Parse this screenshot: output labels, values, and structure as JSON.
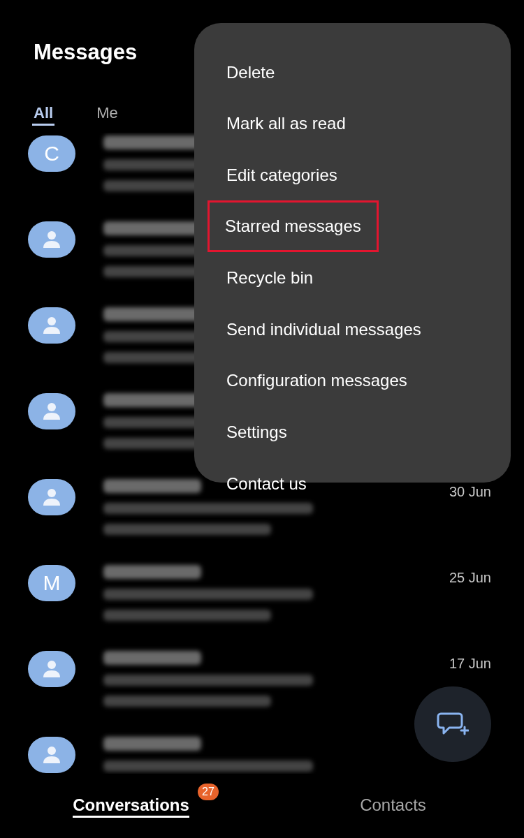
{
  "header": {
    "title": "Messages"
  },
  "filter_tabs": [
    {
      "label": "All",
      "selected": true
    },
    {
      "label": "Me",
      "selected": false
    }
  ],
  "conversations": [
    {
      "avatar": {
        "kind": "letter",
        "letter": "C"
      }
    },
    {
      "avatar": {
        "kind": "person"
      }
    },
    {
      "avatar": {
        "kind": "person"
      }
    },
    {
      "avatar": {
        "kind": "person"
      }
    },
    {
      "avatar": {
        "kind": "person"
      },
      "date": "30 Jun"
    },
    {
      "avatar": {
        "kind": "letter",
        "letter": "M"
      },
      "date": "25 Jun"
    },
    {
      "avatar": {
        "kind": "person"
      },
      "date": "17 Jun"
    },
    {
      "avatar": {
        "kind": "person"
      }
    }
  ],
  "menu": {
    "items": [
      {
        "label": "Delete",
        "highlighted": false
      },
      {
        "label": "Mark all as read",
        "highlighted": false
      },
      {
        "label": "Edit categories",
        "highlighted": false
      },
      {
        "label": "Starred messages",
        "highlighted": true
      },
      {
        "label": "Recycle bin",
        "highlighted": false
      },
      {
        "label": "Send individual messages",
        "highlighted": false
      },
      {
        "label": "Configuration messages",
        "highlighted": false
      },
      {
        "label": "Settings",
        "highlighted": false
      },
      {
        "label": "Contact us",
        "highlighted": false
      }
    ]
  },
  "bottom_tabs": [
    {
      "label": "Conversations",
      "selected": true,
      "badge": "27"
    },
    {
      "label": "Contacts",
      "selected": false
    }
  ]
}
